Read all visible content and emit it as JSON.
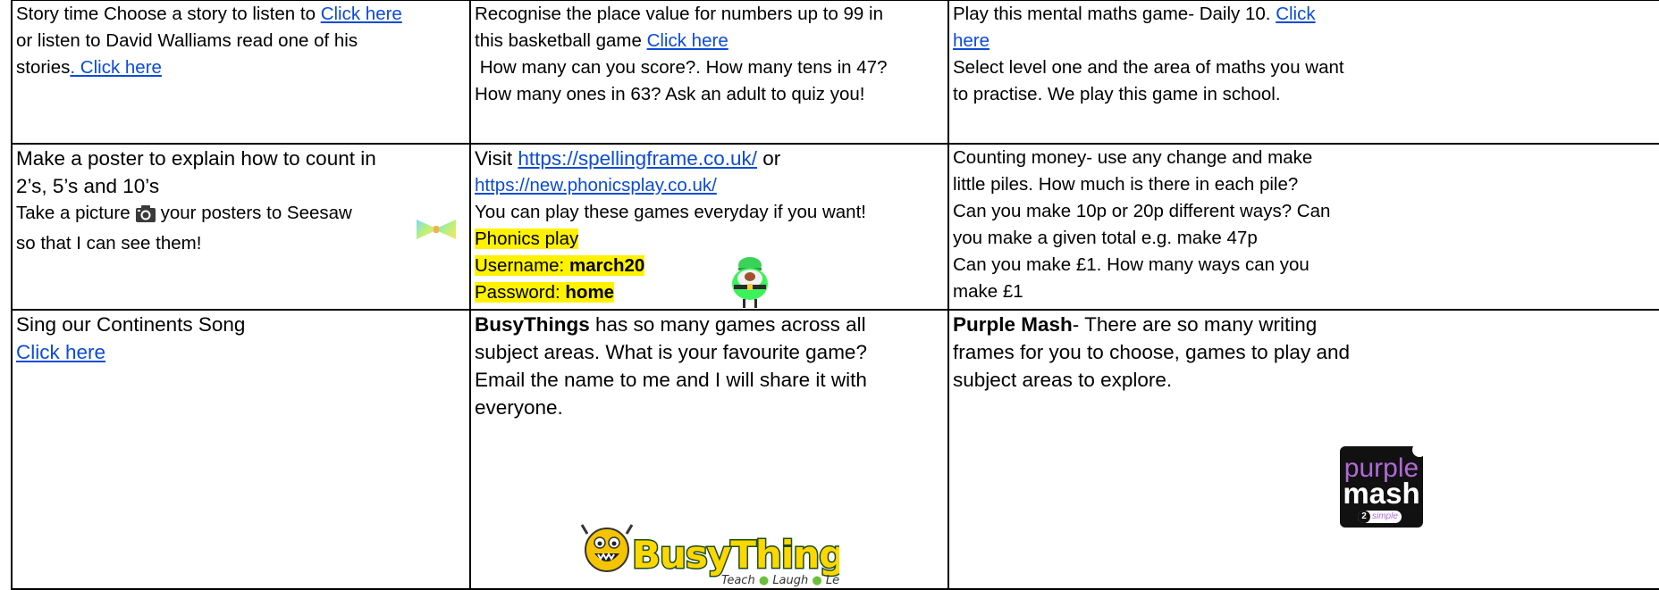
{
  "row1": {
    "story": {
      "text1": "Story time Choose a story to listen to ",
      "link1": "Click here",
      "text2": "or listen to David Walliams read one of his",
      "text3": "stories",
      "link2": ". Click here"
    },
    "place_value": {
      "line1": "Recognise the place value for numbers up to 99 in",
      "line2": "this basketball game ",
      "link": "Click here",
      "line3": " How many can you score?. How many tens in 47?",
      "line4": "How many ones in 63? Ask an adult to quiz you!"
    },
    "mental_maths": {
      "line1": "Play this mental maths game- Daily 10. ",
      "link_part1": "Click",
      "link_part2": "here",
      "line3": "Select level one and the area of maths you want",
      "line4": "to practise. We play this game in school."
    }
  },
  "row2": {
    "poster": {
      "line1": "Make a poster to explain how to count in",
      "line2": "2’s, 5’s and 10’s",
      "line3a": "Take a picture",
      "line3b": "your posters to Seesaw",
      "line4": "so that I can see them!",
      "camera_icon": "camera-icon",
      "bow_icon": "bowtie-icon"
    },
    "phonics": {
      "visit": "Visit ",
      "link1": "https://spellingframe.co.uk/",
      "or": " or",
      "link2": "https://new.phonicsplay.co.uk/",
      "line3": "You can play these games everyday if you want!",
      "hl1": "Phonics play",
      "user_label": "Username: ",
      "user_value": "march20",
      "pass_label": "Password: ",
      "pass_value": "home",
      "image": "leprechaun-icon"
    },
    "money": {
      "line1": "Counting money- use any change and make",
      "line2": "little piles. How much is there in each pile?",
      "line3": "Can you make 10p or 20p different ways? Can",
      "line4": "you make a given total e.g. make 47p",
      "line5": "Can you make £1. How many ways can you",
      "line6": "make £1"
    }
  },
  "row3": {
    "song": {
      "line1": "Sing our Continents Song",
      "link": "Click here"
    },
    "busythings": {
      "bold": "BusyThings",
      "line1": " has so many games across all",
      "line2": "subject areas. What is your favourite game?",
      "line3": "Email the name to me and I will share it with",
      "line4": "everyone.",
      "logo_title": "BusyThings",
      "logo_tag1": "Teach",
      "logo_tag2": "Laugh",
      "logo_tag3": "Learn"
    },
    "purplemash": {
      "bold": "Purple Mash",
      "line1": "- There are so many writing",
      "line2": "frames for you to choose, games to play and",
      "line3": "subject areas to explore.",
      "logo_word1": "purple",
      "logo_word2": "mash",
      "logo_badge_num": "2",
      "logo_badge_text": "simple"
    }
  }
}
